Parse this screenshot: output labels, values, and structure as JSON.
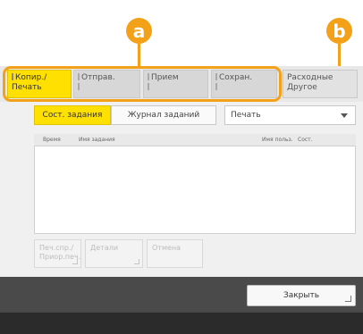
{
  "callouts": {
    "a": "a",
    "b": "b"
  },
  "tabs": [
    {
      "line1": "Копир./",
      "line2": "Печать",
      "active": true
    },
    {
      "line1": "Отправ.",
      "line2": "",
      "active": false
    },
    {
      "line1": "Прием",
      "line2": "",
      "active": false
    },
    {
      "line1": "Сохран.",
      "line2": "",
      "active": false
    },
    {
      "line1": "Расходные",
      "line2": "Другое",
      "active": false
    }
  ],
  "segments": {
    "status": "Сост. задания",
    "log": "Журнал заданий"
  },
  "dropdown": {
    "value": "Печать"
  },
  "columns": {
    "time": "Время",
    "name": "Имя задания",
    "user": "Имя польз.",
    "status": "Сост."
  },
  "buttons": {
    "priority_line1": "Печ.спр./",
    "priority_line2": "Приор.печ.",
    "details": "Детали",
    "cancel": "Отмена"
  },
  "footer": {
    "close": "Закрыть"
  },
  "colors": {
    "accent": "#ffe000",
    "callout": "#f4a11a",
    "footer": "#4a4a4a"
  }
}
